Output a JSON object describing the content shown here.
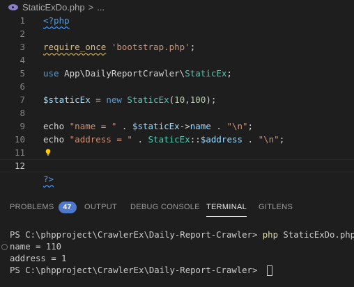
{
  "breadcrumb": {
    "file": "StaticExDo.php",
    "separator": ">",
    "more": "..."
  },
  "editor": {
    "lines": [
      {
        "n": "1"
      },
      {
        "n": "2"
      },
      {
        "n": "3"
      },
      {
        "n": "4"
      },
      {
        "n": "5"
      },
      {
        "n": "6"
      },
      {
        "n": "7"
      },
      {
        "n": "8"
      },
      {
        "n": "9"
      },
      {
        "n": "10"
      },
      {
        "n": "11"
      },
      {
        "n": "12"
      }
    ],
    "code": {
      "l1": "<?php",
      "l3_fn": "require_once",
      "l3_str": "'bootstrap.php'",
      "l3_end": ";",
      "l5_kw": "use",
      "l5_ns": "App\\DailyReportCrawler\\",
      "l5_cls": "StaticEx",
      "l5_end": ";",
      "l7_var": "$staticEx",
      "l7_eq": " = ",
      "l7_new": "new",
      "l7_cls": "StaticEx",
      "l7_open": "(",
      "l7_n1": "10",
      "l7_comma": ",",
      "l7_n2": "100",
      "l7_close": ");",
      "l9_echo": "echo",
      "l9_str": "\"name = \"",
      "l9_dot": " . ",
      "l9_var": "$staticEx",
      "l9_arrow": "->",
      "l9_prop": "name",
      "l9_dot2": " . ",
      "l9_nl": "\"\\n\"",
      "l9_end": ";",
      "l10_echo": "echo",
      "l10_str": "\"address = \"",
      "l10_dot": " . ",
      "l10_cls": "StaticEx",
      "l10_dc": "::",
      "l10_var": "$address",
      "l10_dot2": " . ",
      "l10_nl": "\"\\n\"",
      "l10_end": ";",
      "l12": "?>"
    }
  },
  "panel": {
    "tabs": [
      {
        "label": "PROBLEMS",
        "badge": "47"
      },
      {
        "label": "OUTPUT"
      },
      {
        "label": "DEBUG CONSOLE"
      },
      {
        "label": "TERMINAL"
      },
      {
        "label": "GITLENS"
      }
    ],
    "active_tab": "TERMINAL"
  },
  "terminal": {
    "prompt1": "PS C:\\phpproject\\CrawlerEx\\Daily-Report-Crawler> ",
    "cmd1_php": "php",
    "cmd1_arg": " StaticExDo.php",
    "out1": "name = 110",
    "out2": "address = 1",
    "prompt2": "PS C:\\phpproject\\CrawlerEx\\Daily-Report-Crawler> "
  },
  "colors": {
    "background": "#1e1e1e",
    "badge": "#4d78cc",
    "string": "#ce9178",
    "class": "#4ec9b0",
    "variable": "#9cdcfe",
    "keyword": "#569cd6",
    "number": "#b5cea8"
  },
  "icons": [
    "php-file-icon",
    "lightbulb-icon",
    "terminal-circle-icon"
  ]
}
